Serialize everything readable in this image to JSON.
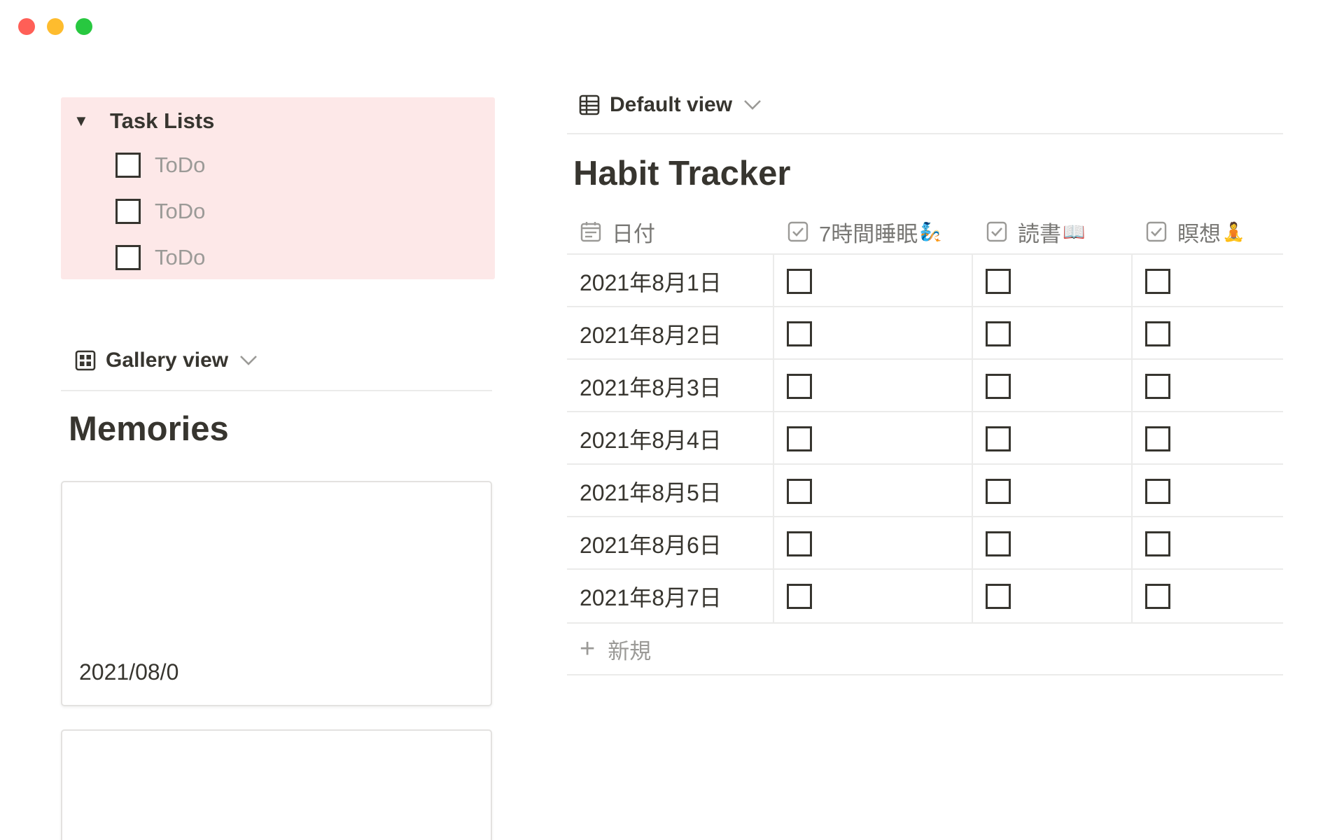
{
  "window": {
    "controls": [
      "close",
      "minimize",
      "zoom"
    ]
  },
  "task_lists": {
    "title": "Task Lists",
    "items": [
      {
        "label": "ToDo",
        "checked": false
      },
      {
        "label": "ToDo",
        "checked": false
      },
      {
        "label": "ToDo",
        "checked": false
      }
    ]
  },
  "gallery": {
    "view_label": "Gallery view",
    "title": "Memories",
    "cards": [
      {
        "label": "2021/08/0"
      },
      {
        "label": ""
      }
    ]
  },
  "habit_tracker": {
    "view_label": "Default view",
    "title": "Habit Tracker",
    "columns": [
      {
        "label": "日付",
        "emoji": "",
        "icon": "calendar-icon"
      },
      {
        "label": "7時間睡眠",
        "emoji": "🧞",
        "icon": "checkbox-property-icon"
      },
      {
        "label": "読書",
        "emoji": "📖",
        "icon": "checkbox-property-icon"
      },
      {
        "label": "瞑想",
        "emoji": "🧘",
        "icon": "checkbox-property-icon"
      }
    ],
    "rows": [
      {
        "date": "2021年8月1日",
        "sleep": false,
        "reading": false,
        "meditation": false
      },
      {
        "date": "2021年8月2日",
        "sleep": false,
        "reading": false,
        "meditation": false
      },
      {
        "date": "2021年8月3日",
        "sleep": false,
        "reading": false,
        "meditation": false
      },
      {
        "date": "2021年8月4日",
        "sleep": false,
        "reading": false,
        "meditation": false
      },
      {
        "date": "2021年8月5日",
        "sleep": false,
        "reading": false,
        "meditation": false
      },
      {
        "date": "2021年8月6日",
        "sleep": false,
        "reading": false,
        "meditation": false
      },
      {
        "date": "2021年8月7日",
        "sleep": false,
        "reading": false,
        "meditation": false
      }
    ],
    "new_label": "新規"
  },
  "colors": {
    "toggle_bg": "#fde8e8",
    "text": "#37352f",
    "muted": "#9b9a97",
    "divider": "#ebebea"
  }
}
